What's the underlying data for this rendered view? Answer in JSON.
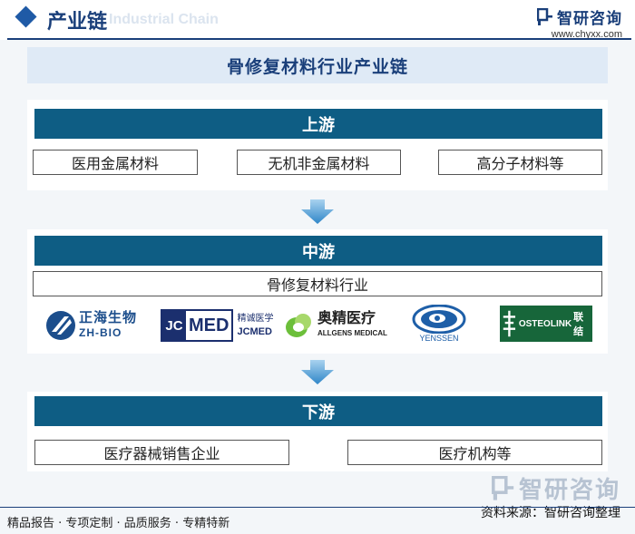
{
  "header": {
    "title": "产业链",
    "subtitle_ghost": "Industrial Chain",
    "brand_name": "智研咨询",
    "brand_url": "www.chyxx.com"
  },
  "diagram": {
    "title": "骨修复材料行业产业链",
    "upstream": {
      "label": "上游",
      "items": [
        "医用金属材料",
        "无机非金属材料",
        "高分子材料等"
      ]
    },
    "midstream": {
      "label": "中游",
      "industry": "骨修复材料行业",
      "companies": [
        {
          "name_cn": "正海生物",
          "name_en": "ZH-BIO"
        },
        {
          "name_en": "JCMED",
          "name_cn": "精诚医学",
          "mark": "JC",
          "word": "MED"
        },
        {
          "name_cn": "奥精医疗",
          "name_en": "ALLGENS MEDICAL"
        },
        {
          "name_en": "YENSSEN"
        },
        {
          "name_en": "OSTEOLINK",
          "name_cn": "联结"
        }
      ]
    },
    "downstream": {
      "label": "下游",
      "items": [
        "医疗器械销售企业",
        "医疗机构等"
      ]
    }
  },
  "footer": {
    "brand_watermark": "智研咨询",
    "source": "资料来源：智研咨询整理",
    "slogan": "精品报告 · 专项定制 · 品质服务 · 专精特新"
  },
  "colors": {
    "band": "#0e5d84",
    "title_bg": "#dfeaf6",
    "accent": "#1a3f7a",
    "arrow": "#3f95d3"
  }
}
